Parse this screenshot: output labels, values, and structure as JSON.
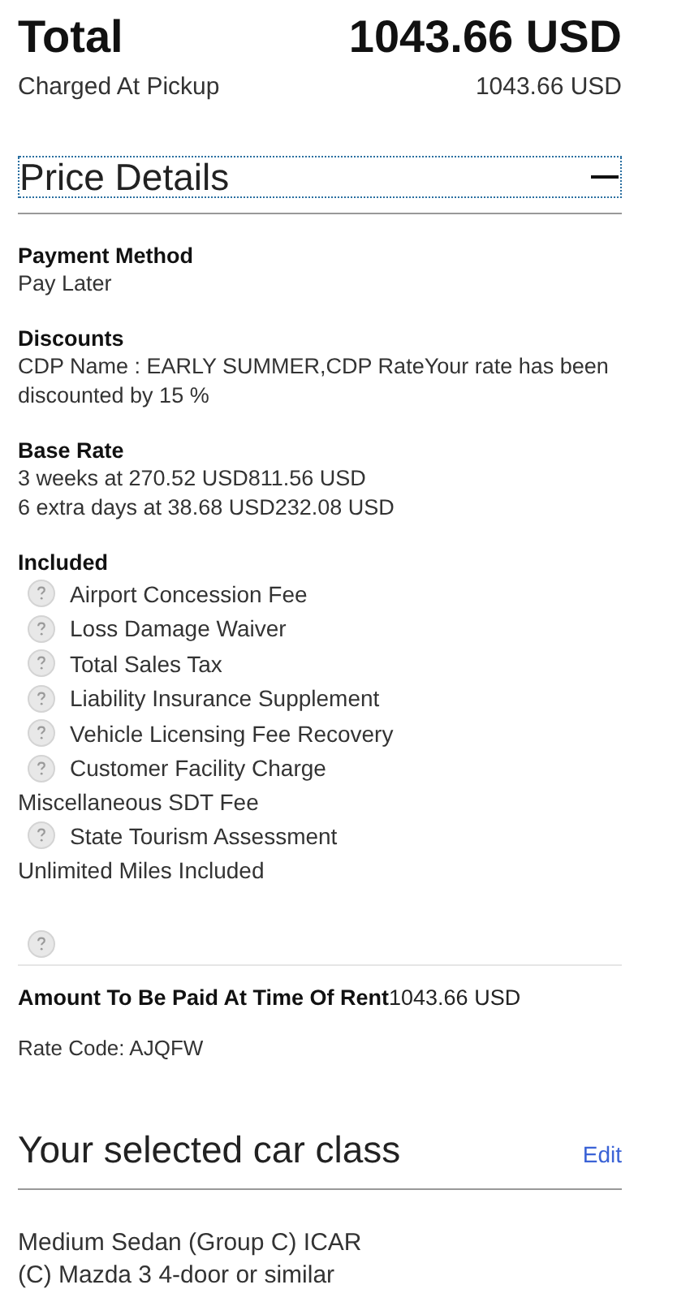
{
  "total": {
    "label": "Total",
    "amount": "1043.66 USD"
  },
  "charged": {
    "label": "Charged At Pickup",
    "amount": "1043.66 USD"
  },
  "price_details": {
    "title": "Price Details",
    "expanded": true,
    "sections": [
      {
        "heading": "Payment Method",
        "lines": [
          "Pay Later"
        ]
      },
      {
        "heading": "Discounts",
        "lines": [
          "CDP Name : EARLY SUMMER,CDP RateYour rate has been discounted by 15 %"
        ]
      },
      {
        "heading": "Base Rate",
        "lines": [
          "3 weeks at 270.52 USD811.56 USD",
          "6 extra days at 38.68 USD232.08 USD"
        ]
      }
    ],
    "included": {
      "heading": "Included",
      "items": [
        {
          "kind": "fee",
          "label": "Airport Concession Fee"
        },
        {
          "kind": "fee",
          "label": "Loss Damage Waiver"
        },
        {
          "kind": "fee",
          "label": "Total Sales Tax"
        },
        {
          "kind": "fee",
          "label": "Liability Insurance Supplement"
        },
        {
          "kind": "fee",
          "label": "Vehicle Licensing Fee Recovery"
        },
        {
          "kind": "fee",
          "label": "Customer Facility Charge"
        },
        {
          "kind": "note",
          "label": "Miscellaneous SDT Fee"
        },
        {
          "kind": "fee",
          "label": "State Tourism Assessment"
        },
        {
          "kind": "note",
          "label": "Unlimited Miles Included"
        },
        {
          "kind": "help"
        }
      ]
    },
    "amount_due": {
      "label": "Amount To Be Paid At Time Of Rent",
      "amount": "1043.66 USD"
    },
    "rate_code": "Rate Code: AJQFW"
  },
  "car_class": {
    "title": "Your selected car class",
    "edit": "Edit",
    "lines": [
      "Medium Sedan (Group C) ICAR",
      "(C) Mazda 3 4-door or similar"
    ]
  }
}
